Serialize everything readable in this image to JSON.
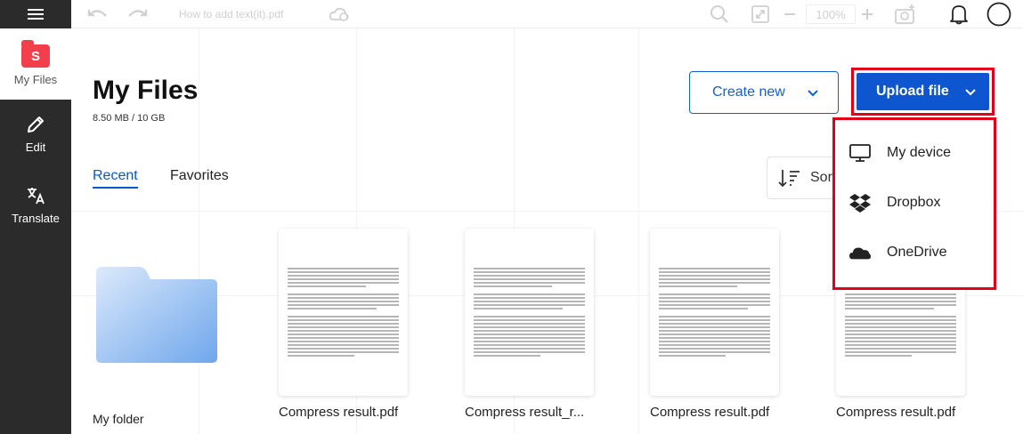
{
  "toolbar": {
    "doc_title": "How to add text(it).pdf",
    "zoom_value": "100%",
    "menu_icon": "hamburger-menu-icon",
    "undo_icon": "undo-icon",
    "redo_icon": "redo-icon",
    "cloud_icon": "cloud-sync-icon",
    "search_icon": "search-icon",
    "fit_icon": "fit-screen-icon",
    "zoom_out_icon": "minus-icon",
    "zoom_in_icon": "plus-icon",
    "add_image_icon": "add-image-icon",
    "bell_icon": "bell-icon",
    "avatar_icon": "avatar-icon"
  },
  "sidebar": {
    "items": [
      {
        "label": "My Files",
        "icon": "smallpdf-logo-icon"
      },
      {
        "label": "Edit",
        "icon": "pencil-icon"
      },
      {
        "label": "Translate",
        "icon": "translate-icon"
      }
    ]
  },
  "main": {
    "title": "My Files",
    "storage": "8.50 MB / 10 GB",
    "tabs": [
      {
        "label": "Recent",
        "active": true
      },
      {
        "label": "Favorites",
        "active": false
      }
    ],
    "create_new_label": "Create new",
    "upload_label": "Upload file",
    "sort_label": "Sor"
  },
  "upload_menu": {
    "items": [
      {
        "label": "My device",
        "icon": "monitor-icon"
      },
      {
        "label": "Dropbox",
        "icon": "dropbox-icon"
      },
      {
        "label": "OneDrive",
        "icon": "onedrive-icon"
      }
    ]
  },
  "files": [
    {
      "name": "My folder",
      "type": "folder"
    },
    {
      "name": "Compress result.pdf",
      "type": "pdf"
    },
    {
      "name": "Compress result_r...",
      "type": "pdf"
    },
    {
      "name": "Compress result.pdf",
      "type": "pdf"
    },
    {
      "name": "Compress result.pdf",
      "type": "pdf"
    }
  ],
  "colors": {
    "accent": "#0d56cf",
    "highlight_border": "#e3001b",
    "sidebar_bg": "#2b2b2b",
    "brand_red": "#f23f4b",
    "folder": "#7fb3ef"
  }
}
